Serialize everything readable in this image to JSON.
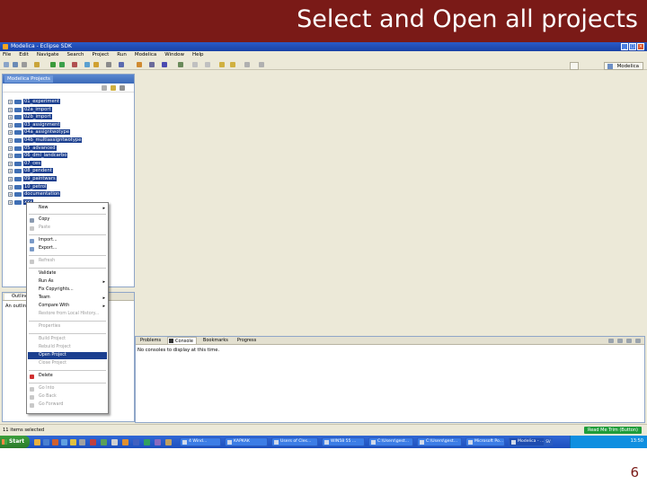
{
  "slide": {
    "title": "Select and Open all projects",
    "page_number": "6"
  },
  "window": {
    "title": "Modelica - Eclipse SDK",
    "menu": [
      "File",
      "Edit",
      "Navigate",
      "Search",
      "Project",
      "Run",
      "Modelica",
      "Window",
      "Help"
    ],
    "perspective": "Modelica"
  },
  "project_explorer": {
    "tab_label": "Modelica Projects",
    "projects": [
      "01_experiment",
      "02a_import",
      "02b_import",
      "03_assignment",
      "04a_assigntwotype",
      "04b_multiassigntwotype",
      "05_advanced",
      "06_dml_landcarbo",
      "07_ces",
      "08_pendent",
      "09_paintwars",
      "10_petrol",
      "documentation",
      "xxx"
    ]
  },
  "outline": {
    "tab_label": "Outline",
    "message": "An outline is not available."
  },
  "context_menu": {
    "items": [
      {
        "label": "New",
        "submenu": true,
        "disabled": false
      },
      {
        "label": "Copy",
        "disabled": false
      },
      {
        "label": "Paste",
        "disabled": true
      },
      {
        "label": "Import...",
        "disabled": false
      },
      {
        "label": "Export...",
        "disabled": false
      },
      {
        "label": "Refresh",
        "disabled": true
      },
      {
        "label": "Validate",
        "disabled": false
      },
      {
        "label": "Run As",
        "submenu": true,
        "disabled": false
      },
      {
        "label": "Fix Copyrights...",
        "disabled": false
      },
      {
        "label": "Team",
        "submenu": true,
        "disabled": false
      },
      {
        "label": "Compare With",
        "submenu": true,
        "disabled": false
      },
      {
        "label": "Restore from Local History...",
        "disabled": true
      },
      {
        "label": "Properties",
        "disabled": true
      },
      {
        "label": "Build Project",
        "disabled": true
      },
      {
        "label": "Rebuild Project",
        "disabled": true
      },
      {
        "label": "Open Project",
        "disabled": false,
        "selected": true
      },
      {
        "label": "Close Project",
        "disabled": true
      },
      {
        "label": "Delete",
        "disabled": false
      },
      {
        "label": "Go Into",
        "disabled": true
      },
      {
        "label": "Go Back",
        "disabled": true
      },
      {
        "label": "Go Forward",
        "disabled": true
      }
    ]
  },
  "console": {
    "tabs": [
      "Problems",
      "Console",
      "Bookmarks",
      "Progress"
    ],
    "active_tab": "Console",
    "message": "No consoles to display at this time."
  },
  "status": {
    "selection": "11 items selected",
    "button": "Read Me Trim (Button)"
  },
  "taskbar": {
    "start": "Start",
    "tasks": [
      "4 Wind...",
      "KAPKAK",
      "Users of Cles...",
      "WIN58 55 ...",
      "C:\\Users\\gest...",
      "C:\\Users\\gest...",
      "Microsoft Po...",
      "Modelica - ..."
    ],
    "language": "SV",
    "clock": "13:50"
  },
  "colors": {
    "slide_header": "#7a1a17",
    "selection": "#1b3f8f",
    "status_button": "#1f9d3a"
  }
}
